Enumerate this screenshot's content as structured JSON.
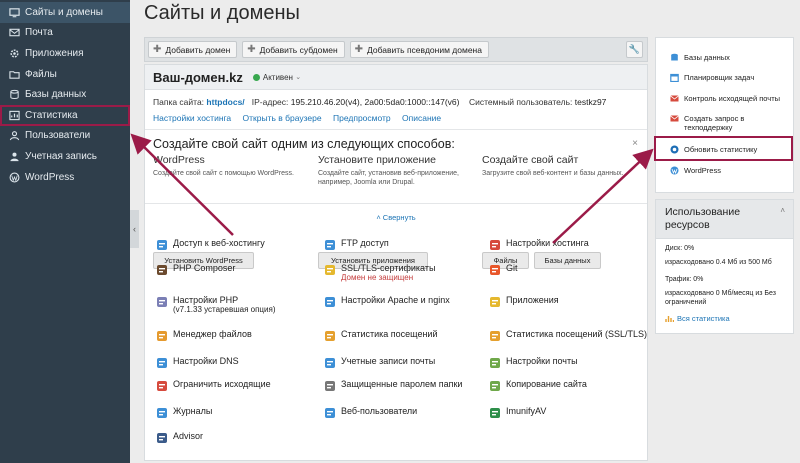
{
  "sidebar": {
    "items": [
      {
        "label": "Сайты и домены",
        "icon": "monitor-icon"
      },
      {
        "label": "Почта",
        "icon": "mail-icon"
      },
      {
        "label": "Приложения",
        "icon": "gear-icon"
      },
      {
        "label": "Файлы",
        "icon": "folder-icon"
      },
      {
        "label": "Базы данных",
        "icon": "database-icon"
      },
      {
        "label": "Статистика",
        "icon": "stats-icon"
      },
      {
        "label": "Пользователи",
        "icon": "user-icon"
      },
      {
        "label": "Учетная запись",
        "icon": "account-icon"
      },
      {
        "label": "WordPress",
        "icon": "wordpress-icon"
      }
    ]
  },
  "page": {
    "title": "Сайты и домены"
  },
  "toolbar": {
    "add_domain": "Добавить домен",
    "add_subdomain": "Добавить субдомен",
    "add_alias": "Добавить псевдоним домена"
  },
  "domain": {
    "name": "Ваш-домен.kz",
    "status": "Активен",
    "folder_label": "Папка сайта:",
    "folder_value": "httpdocs/",
    "ip_label": "IP-адрес:",
    "ip_value": "195.210.46.20(v4), 2a00:5da0:1000::147(v6)",
    "sysuser_label": "Системный пользователь:",
    "sysuser_value": "testkz97",
    "links": [
      "Настройки хостинга",
      "Открыть в браузере",
      "Предпросмотр",
      "Описание"
    ]
  },
  "create": {
    "title": "Создайте свой сайт одним из следующих способов:",
    "close": "×",
    "wordpress": {
      "heading": "WordPress",
      "desc": "Создайте свой сайт с помощью WordPress.",
      "button": "Установить WordPress"
    },
    "app": {
      "heading": "Установите приложение",
      "desc": "Создайте сайт, установив веб-приложение, например, Joomla или Drupal.",
      "button": "Установить приложения"
    },
    "site": {
      "heading": "Создайте свой сайт",
      "desc": "Загрузите свой веб-контент и базы данных.",
      "button_files": "Файлы",
      "button_db": "Базы данных"
    },
    "collapse": "˄ Свернуть"
  },
  "features": [
    {
      "label": "Доступ к веб-хостингу",
      "icon": "hosting-access-icon",
      "color": "#3d8fd6"
    },
    {
      "label": "FTP доступ",
      "icon": "ftp-icon",
      "color": "#3d8fd6"
    },
    {
      "label": "Настройки хостинга",
      "icon": "hosting-settings-icon",
      "color": "#d64a3d"
    },
    {
      "label": "PHP Composer",
      "icon": "composer-icon",
      "color": "#6b4a2e"
    },
    {
      "label": "SSL/TLS-сертификаты",
      "icon": "ssl-icon",
      "color": "#e5b82e",
      "sub": "Домен не защищен"
    },
    {
      "label": "Git",
      "icon": "git-icon",
      "color": "#e8572b"
    },
    {
      "label": "Настройки PHP",
      "icon": "php-icon",
      "color": "#7b7fb5",
      "sub_version": "(v7.1.33",
      "sub_old": "устаревшая опция",
      "sub_close": ")"
    },
    {
      "label": "Настройки Apache и nginx",
      "icon": "apache-nginx-icon",
      "color": "#3d8fd6"
    },
    {
      "label": "Приложения",
      "icon": "apps-icon",
      "color": "#e5b82e"
    },
    {
      "label": "Менеджер файлов",
      "icon": "file-manager-icon",
      "color": "#e59a2e"
    },
    {
      "label": "Статистика посещений",
      "icon": "visit-stats-icon",
      "color": "#e5a02e"
    },
    {
      "label": "Статистика посещений (SSL/TLS)",
      "icon": "visit-stats-ssl-icon",
      "color": "#e5a02e"
    },
    {
      "label": "Настройки DNS",
      "icon": "dns-icon",
      "color": "#3d8fd6"
    },
    {
      "label": "Учетные записи почты",
      "icon": "mail-accounts-icon",
      "color": "#3d8fd6"
    },
    {
      "label": "Настройки почты",
      "icon": "mail-settings-icon",
      "color": "#6fa84a"
    },
    {
      "label": "Ограничить исходящие",
      "icon": "limit-outgoing-icon",
      "color": "#d64a3d"
    },
    {
      "label": "Защищенные паролем папки",
      "icon": "protected-folders-icon",
      "color": "#777777"
    },
    {
      "label": "Копирование сайта",
      "icon": "site-copy-icon",
      "color": "#6fa84a"
    },
    {
      "label": "Журналы",
      "icon": "logs-icon",
      "color": "#3d8fd6"
    },
    {
      "label": "Веб-пользователи",
      "icon": "web-users-icon",
      "color": "#3d8fd6"
    },
    {
      "label": "ImunifyAV",
      "icon": "imunify-icon",
      "color": "#2e8f4a"
    },
    {
      "label": "Advisor",
      "icon": "advisor-icon",
      "color": "#3b5b8a"
    }
  ],
  "right_panel": {
    "items": [
      {
        "label": "Базы данных",
        "icon": "database-icon",
        "color": "#3d8fd6"
      },
      {
        "label": "Планировщик задач",
        "icon": "scheduler-icon",
        "color": "#3d8fd6"
      },
      {
        "label": "Контроль исходящей почты",
        "icon": "outgoing-mail-icon",
        "color": "#d64a3d"
      },
      {
        "label": "Создать запрос в техподдержку",
        "icon": "support-icon",
        "color": "#d64a3d"
      },
      {
        "label": "Обновить статистику",
        "icon": "refresh-stats-icon",
        "color": "#1c6db5"
      },
      {
        "label": "WordPress",
        "icon": "wordpress-icon",
        "color": "#3d8fd6"
      }
    ]
  },
  "usage": {
    "title": "Использование ресурсов",
    "disk_label": "Диск: 0%",
    "disk_used": "израсходовано 0.4 Мб из 500 Мб",
    "traffic_label": "Трафик: 0%",
    "traffic_used": "израсходовано 0 Мб/месяц из Без ограничений",
    "all_stats": "Вся статистика"
  },
  "colors": {
    "sidebar_bg": "#2f3e4b",
    "link": "#1c74b5",
    "highlight": "#9b1b48"
  }
}
